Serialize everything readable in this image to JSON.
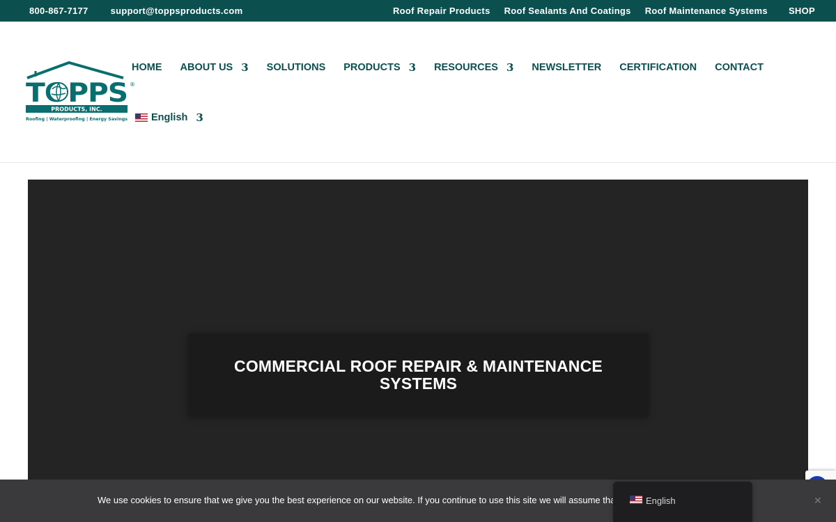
{
  "topbar": {
    "phone": "800-867-7177",
    "email": "support@toppsproducts.com",
    "links": [
      "Roof Repair Products",
      "Roof Sealants And Coatings",
      "Roof Maintenance Systems"
    ],
    "shop": "SHOP"
  },
  "logo": {
    "name": "TOPPS",
    "sub": "PRODUCTS, INC.",
    "tagline": "Roofing | Waterproofing | Energy Savings"
  },
  "nav": {
    "items": [
      {
        "label": "HOME",
        "has_dropdown": false
      },
      {
        "label": "ABOUT US",
        "has_dropdown": true
      },
      {
        "label": "SOLUTIONS",
        "has_dropdown": false
      },
      {
        "label": "PRODUCTS",
        "has_dropdown": true
      },
      {
        "label": "RESOURCES",
        "has_dropdown": true
      },
      {
        "label": "NEWSLETTER",
        "has_dropdown": false
      },
      {
        "label": "CERTIFICATION",
        "has_dropdown": false
      },
      {
        "label": "CONTACT",
        "has_dropdown": false
      }
    ],
    "dropdown_glyph": "3",
    "language": "English"
  },
  "hero": {
    "title": "COMMERCIAL ROOF REPAIR & MAINTENANCE SYSTEMS"
  },
  "cookie": {
    "message": "We use cookies to ensure that we give you the best experience on our website. If you continue to use this site we will assume that you are happy with it.",
    "close": "✕"
  },
  "language_switcher": {
    "label": "English"
  },
  "colors": {
    "brand": "#0b4f4f",
    "hero_bg": "#242424",
    "cookie_bg": "#3a3a3d"
  }
}
